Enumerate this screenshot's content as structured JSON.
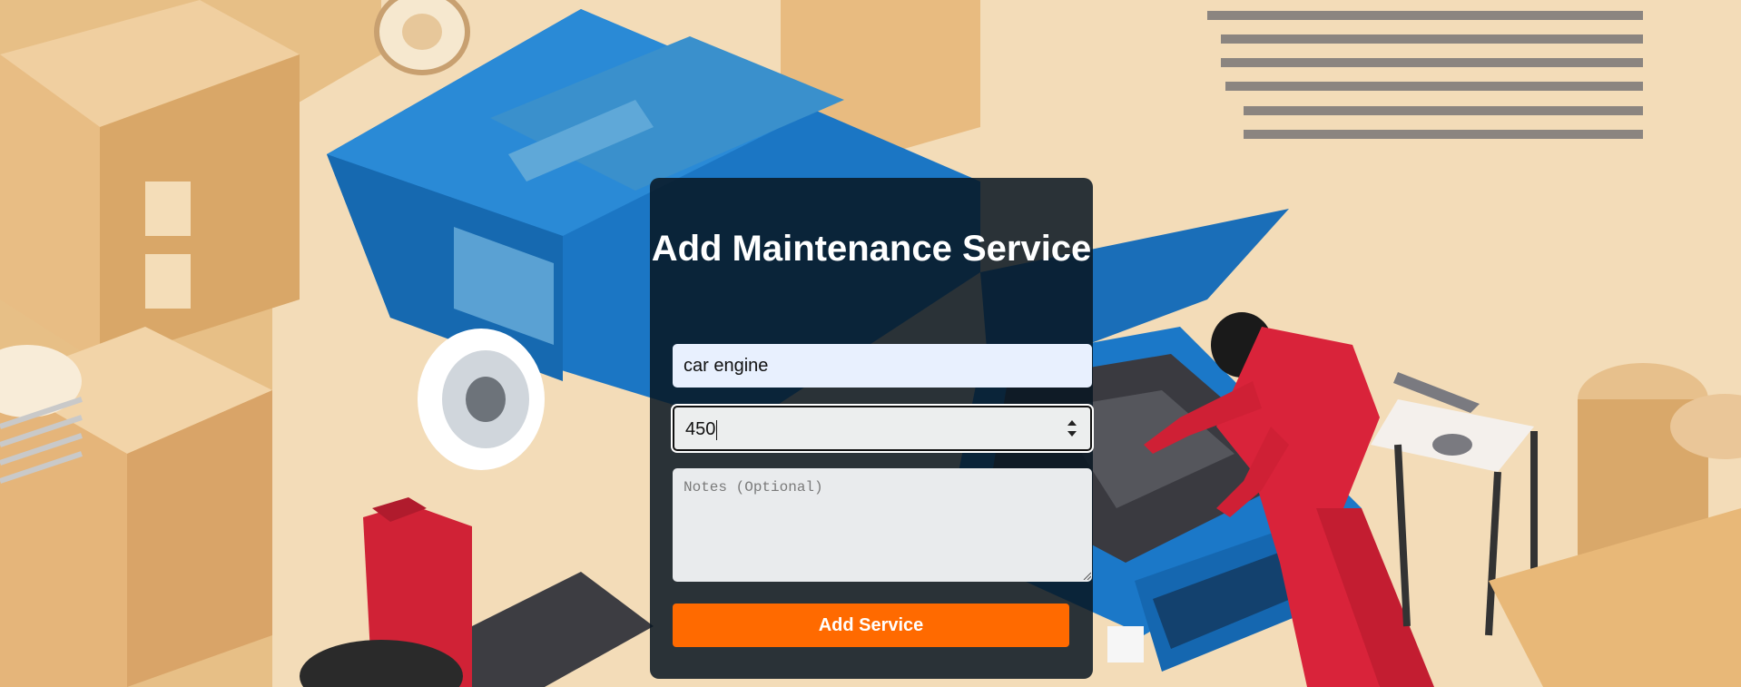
{
  "form": {
    "title": "Add Maintenance Service",
    "service_name_value": "car engine",
    "cost_value": "450",
    "notes_placeholder": "Notes (Optional)",
    "submit_label": "Add Service"
  },
  "colors": {
    "card_background": "#081622",
    "submit_button": "#ff6a00",
    "name_field": "#e8f0fe",
    "car_body": "#1b76c4",
    "mechanic_suit": "#d9233a",
    "warehouse_tone": "#e8b878"
  },
  "background": {
    "illustration": "isometric-garage-mechanic-repairing-blue-car"
  }
}
